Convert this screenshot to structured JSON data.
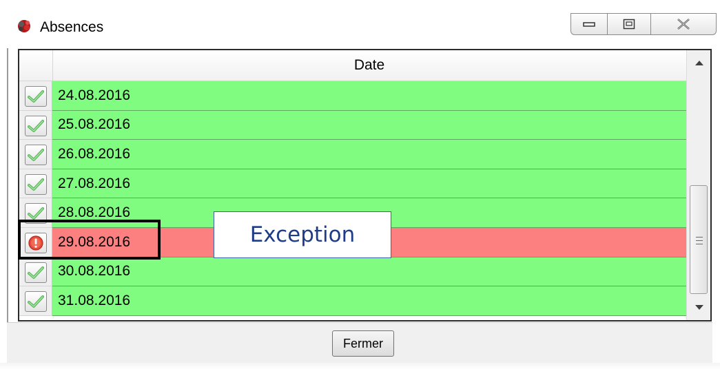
{
  "window": {
    "title": "Absences",
    "icons": {
      "app": "app-logo-icon",
      "minimize": "minimize-icon",
      "maximize": "maximize-icon",
      "close": "close-icon"
    }
  },
  "grid": {
    "column_header": "Date",
    "rows": [
      {
        "date": "24.08.2016",
        "status": "ok",
        "icon": "check-icon"
      },
      {
        "date": "25.08.2016",
        "status": "ok",
        "icon": "check-icon"
      },
      {
        "date": "26.08.2016",
        "status": "ok",
        "icon": "check-icon"
      },
      {
        "date": "27.08.2016",
        "status": "ok",
        "icon": "check-icon"
      },
      {
        "date": "28.08.2016",
        "status": "ok",
        "icon": "check-icon"
      },
      {
        "date": "29.08.2016",
        "status": "error",
        "icon": "exclamation-icon"
      },
      {
        "date": "30.08.2016",
        "status": "ok",
        "icon": "check-icon"
      },
      {
        "date": "31.08.2016",
        "status": "ok",
        "icon": "check-icon"
      }
    ],
    "colors": {
      "ok": "#80fc80",
      "error": "#fc8080"
    }
  },
  "annotation": {
    "label": "Exception",
    "border_color": "#3c5fa8",
    "text_color": "#1f3c88"
  },
  "footer": {
    "close_label": "Fermer"
  }
}
